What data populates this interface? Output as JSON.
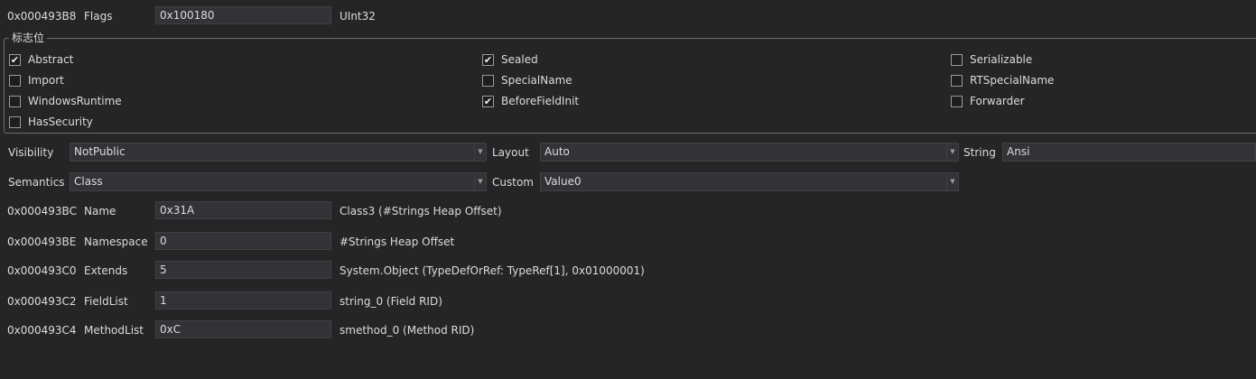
{
  "flags_row": {
    "offset": "0x000493B8",
    "name": "Flags",
    "value": "0x100180",
    "desc": "UInt32"
  },
  "group": {
    "title": "标志位",
    "checks": [
      {
        "label": "Abstract",
        "checked": true
      },
      {
        "label": "Import",
        "checked": false
      },
      {
        "label": "WindowsRuntime",
        "checked": false
      },
      {
        "label": "HasSecurity",
        "checked": false
      },
      {
        "label": "Sealed",
        "checked": true
      },
      {
        "label": "SpecialName",
        "checked": false
      },
      {
        "label": "BeforeFieldInit",
        "checked": true
      },
      {
        "label": "Serializable",
        "checked": false
      },
      {
        "label": "RTSpecialName",
        "checked": false
      },
      {
        "label": "Forwarder",
        "checked": false
      }
    ]
  },
  "combos": {
    "visibility": {
      "label": "Visibility",
      "value": "NotPublic"
    },
    "layout": {
      "label": "Layout",
      "value": "Auto"
    },
    "string": {
      "label": "String",
      "value": "Ansi"
    },
    "semantics": {
      "label": "Semantics",
      "value": "Class"
    },
    "custom": {
      "label": "Custom",
      "value": "Value0"
    }
  },
  "rows": [
    {
      "offset": "0x000493BC",
      "name": "Name",
      "value": "0x31A",
      "desc": "Class3 (#Strings Heap Offset)"
    },
    {
      "offset": "0x000493BE",
      "name": "Namespace",
      "value": "0",
      "desc": "#Strings Heap Offset"
    },
    {
      "offset": "0x000493C0",
      "name": "Extends",
      "value": "5",
      "desc": "System.Object (TypeDefOrRef: TypeRef[1], 0x01000001)"
    },
    {
      "offset": "0x000493C2",
      "name": "FieldList",
      "value": "1",
      "desc": "string_0 (Field RID)"
    },
    {
      "offset": "0x000493C4",
      "name": "MethodList",
      "value": "0xC",
      "desc": "smethod_0 (Method RID)"
    }
  ]
}
